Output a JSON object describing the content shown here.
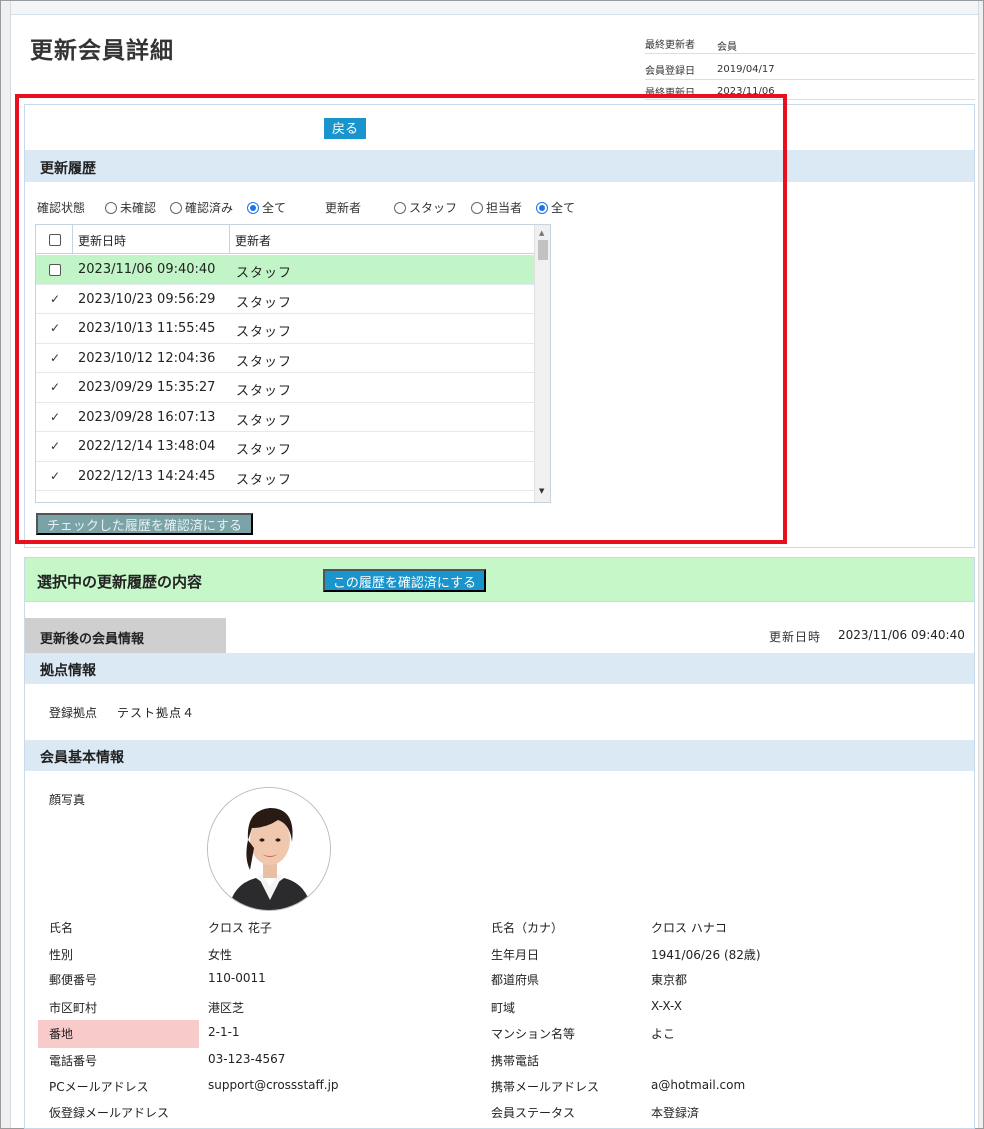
{
  "page": {
    "title": "更新会員詳細"
  },
  "meta": [
    {
      "label": "最終更新者",
      "value": "会員"
    },
    {
      "label": "会員登録日",
      "value": "2019/04/17"
    },
    {
      "label": "最終更新日",
      "value": "2023/11/06"
    }
  ],
  "history": {
    "back_label": "戻る",
    "section_title": "更新履歴",
    "filters": {
      "status_label": "確認状態",
      "status_options": [
        "未確認",
        "確認済み",
        "全て"
      ],
      "status_selected": "全て",
      "updater_label": "更新者",
      "updater_options": [
        "スタッフ",
        "担当者",
        "全て"
      ],
      "updater_selected": "全て"
    },
    "columns": [
      "更新日時",
      "更新者"
    ],
    "rows": [
      {
        "checked_mark": "",
        "datetime": "2023/11/06 09:40:40",
        "updater": "スタッフ",
        "selected": true
      },
      {
        "checked_mark": "✓",
        "datetime": "2023/10/23 09:56:29",
        "updater": "スタッフ"
      },
      {
        "checked_mark": "✓",
        "datetime": "2023/10/13 11:55:45",
        "updater": "スタッフ"
      },
      {
        "checked_mark": "✓",
        "datetime": "2023/10/12 12:04:36",
        "updater": "スタッフ"
      },
      {
        "checked_mark": "✓",
        "datetime": "2023/09/29 15:35:27",
        "updater": "スタッフ"
      },
      {
        "checked_mark": "✓",
        "datetime": "2023/09/28 16:07:13",
        "updater": "スタッフ"
      },
      {
        "checked_mark": "✓",
        "datetime": "2022/12/14 13:48:04",
        "updater": "スタッフ"
      },
      {
        "checked_mark": "✓",
        "datetime": "2022/12/13 14:24:45",
        "updater": "スタッフ"
      }
    ],
    "confirm_checked_label": "チェックした履歴を確認済にする"
  },
  "detail": {
    "title": "選択中の更新履歴の内容",
    "confirm_this_label": "この履歴を確認済にする",
    "tab_label": "更新後の会員情報",
    "updated_at_label": "更新日時",
    "updated_at_value": "2023/11/06 09:40:40",
    "base_section": "拠点情報",
    "base_label": "登録拠点",
    "base_value": "テスト拠点４",
    "member_section": "会員基本情報",
    "photo_label": "顔写真",
    "fields_left": [
      {
        "label": "氏名",
        "value": "クロス 花子"
      },
      {
        "label": "性別",
        "value": "女性"
      },
      {
        "label": "郵便番号",
        "value": "110-0011"
      },
      {
        "label": "市区町村",
        "value": "港区芝"
      },
      {
        "label": "番地",
        "value": "2-1-1"
      },
      {
        "label": "電話番号",
        "value": "03-123-4567"
      },
      {
        "label": "PCメールアドレス",
        "value": "support@crossstaff.jp"
      },
      {
        "label": "仮登録メールアドレス",
        "value": ""
      }
    ],
    "fields_right": [
      {
        "label": "氏名（カナ）",
        "value": "クロス ハナコ"
      },
      {
        "label": "生年月日",
        "value": "1941/06/26  (82歳)"
      },
      {
        "label": "都道府県",
        "value": "東京都"
      },
      {
        "label": "町域",
        "value": "X-X-X"
      },
      {
        "label": "マンション名等",
        "value": "よこ"
      },
      {
        "label": "携帯電話",
        "value": ""
      },
      {
        "label": "携帯メールアドレス",
        "value": "a@hotmail.com"
      },
      {
        "label": "会員ステータス",
        "value": "本登録済"
      }
    ]
  },
  "colors": {
    "accent": "#1a94cc",
    "highlight_row": "#c1f5c7",
    "band": "#dbe9f5",
    "changed_field": "#f9caca",
    "annotation": "#e8101c"
  }
}
